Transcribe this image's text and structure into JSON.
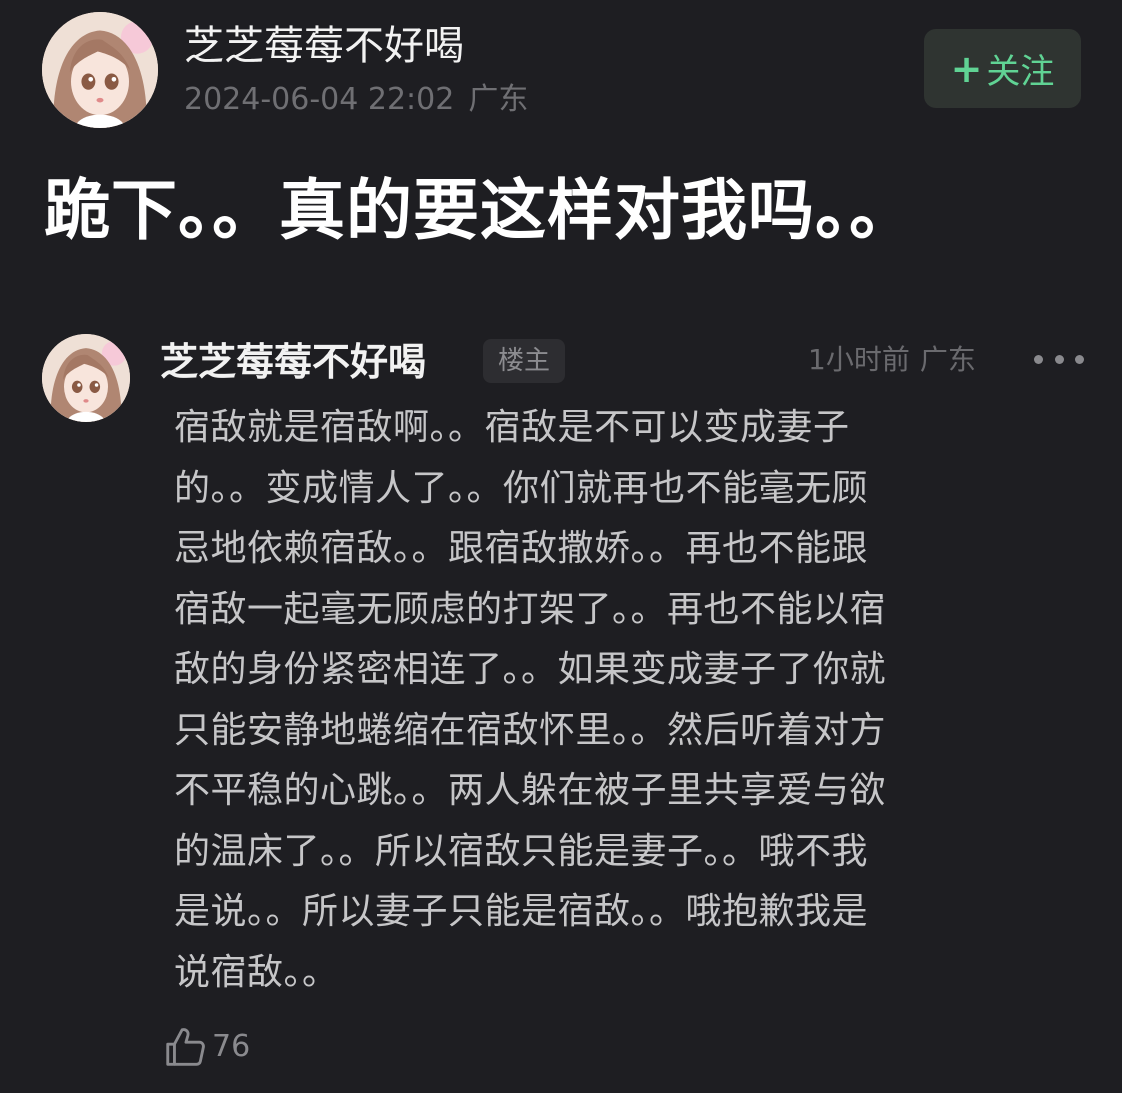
{
  "post": {
    "author": "芝芝莓莓不好喝",
    "timestamp": "2024-06-04 22:02",
    "location": "广东",
    "follow_button": {
      "icon": "plus-icon",
      "icon_glyph": "+",
      "label": "关注",
      "color": "#60d394"
    },
    "title": "跪下。。真的要这样对我吗。。"
  },
  "comment": {
    "author": "芝芝莓莓不好喝",
    "badge": "楼主",
    "time_ago": "1小时前",
    "location": "广东",
    "more_icon": "more-dots-icon",
    "lines": [
      "宿敌就是宿敌啊。。宿敌是不可以变成妻子",
      "的。。变成情人了。。你们就再也不能毫无顾",
      "忌地依赖宿敌。。跟宿敌撒娇。。再也不能跟",
      "宿敌一起毫无顾虑的打架了。。再也不能以宿",
      "敌的身份紧密相连了。。如果变成妻子了你就",
      "只能安静地蜷缩在宿敌怀里。。然后听着对方",
      "不平稳的心跳。。两人躲在被子里共享爱与欲",
      "的温床了。。所以宿敌只能是妻子。。哦不我",
      "是说。。所以妻子只能是宿敌。。哦抱歉我是",
      "说宿敌。。"
    ],
    "like_icon": "thumbs-up-icon",
    "likes": "76"
  },
  "colors": {
    "background": "#1e1e22",
    "accent": "#60d394",
    "primary_text": "#f2f2f2",
    "body_text": "#c6c6c8",
    "secondary_text": "#6f6f73"
  }
}
